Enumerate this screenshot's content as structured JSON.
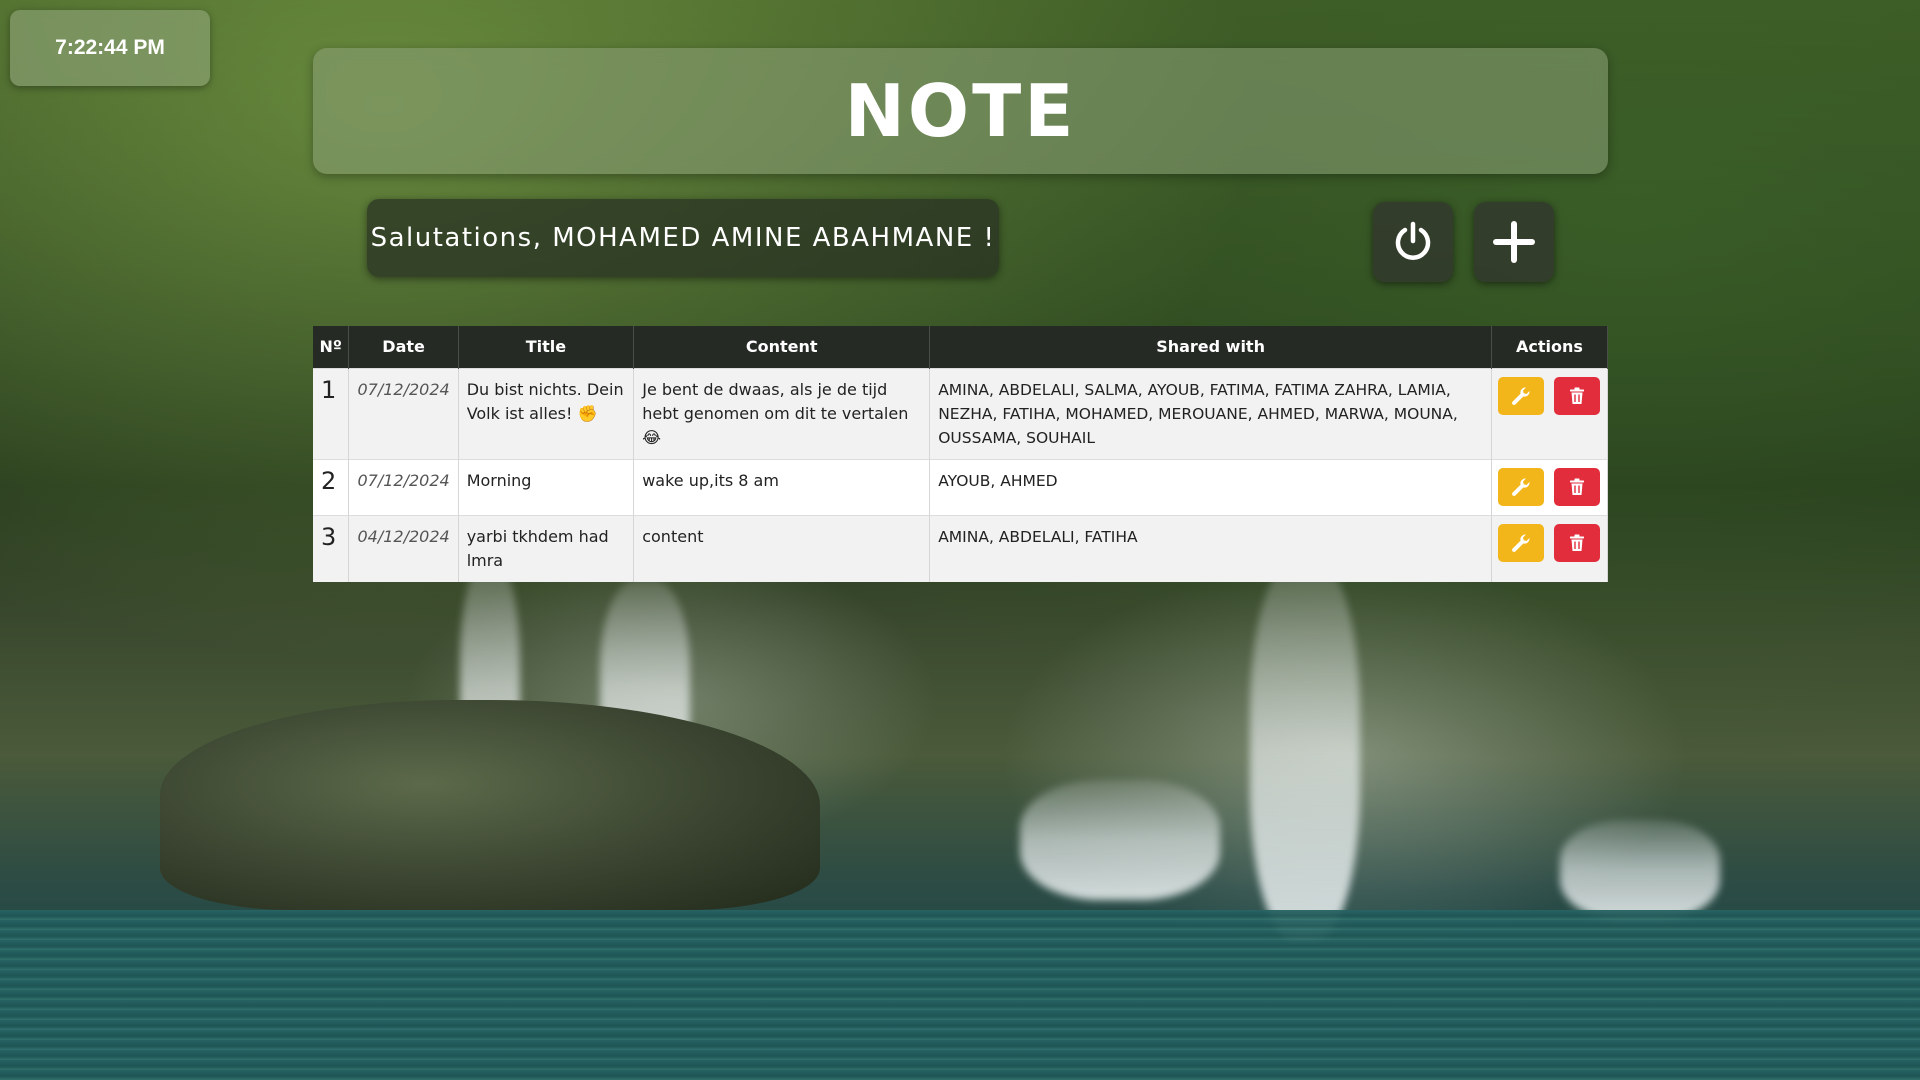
{
  "clock": {
    "time": "7:22:44 PM"
  },
  "banner": {
    "title": "NOTE"
  },
  "greeting": {
    "text": "Salutations, MOHAMED AMINE ABAHMANE !"
  },
  "toolbar": {
    "power_icon": "power-icon",
    "add_icon": "plus-icon"
  },
  "table": {
    "headers": {
      "num": "Nº",
      "date": "Date",
      "title": "Title",
      "content": "Content",
      "shared": "Shared with",
      "actions": "Actions"
    },
    "rows": [
      {
        "num": "1",
        "date": "07/12/2024",
        "title": "Du bist nichts. Dein Volk ist alles! ✊",
        "content": "Je bent de dwaas, als je de tijd hebt genomen om dit te vertalen 😂",
        "shared": "AMINA, ABDELALI, SALMA, AYOUB, FATIMA, FATIMA ZAHRA, LAMIA, NEZHA, FATIHA, MOHAMED, MEROUANE, AHMED, MARWA, MOUNA, OUSSAMA, SOUHAIL"
      },
      {
        "num": "2",
        "date": "07/12/2024",
        "title": "Morning",
        "content": "wake up,its 8 am",
        "shared": "AYOUB, AHMED"
      },
      {
        "num": "3",
        "date": "04/12/2024",
        "title": "yarbi tkhdem had lmra",
        "content": "content",
        "shared": "AMINA, ABDELALI, FATIHA"
      }
    ]
  },
  "colors": {
    "edit_button": "#f2b51a",
    "delete_button": "#e12d3c",
    "header_bg": "#262a25"
  }
}
